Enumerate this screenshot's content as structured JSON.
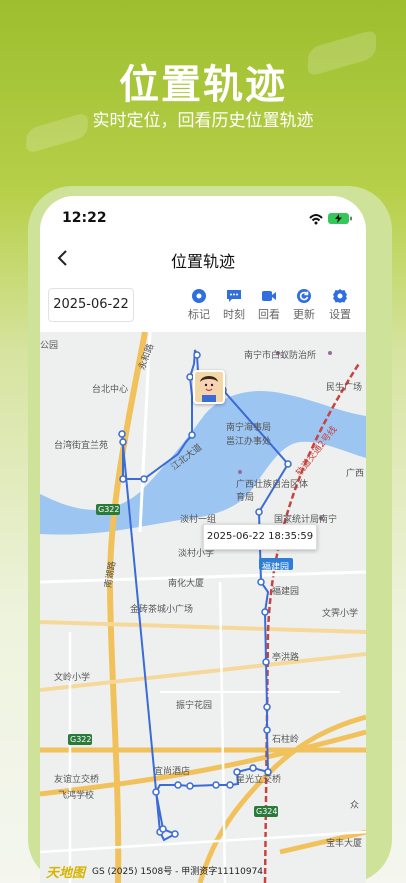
{
  "promo": {
    "title": "位置轨迹",
    "subtitle": "实时定位，回看历史位置轨迹"
  },
  "status_bar": {
    "time": "12:22"
  },
  "nav": {
    "title": "位置轨迹"
  },
  "toolbar": {
    "date": "2025-06-22",
    "tools": [
      "标记",
      "时刻",
      "回看",
      "更新",
      "设置"
    ]
  },
  "map": {
    "tooltip": "2025-06-22 18:35:59",
    "labels": {
      "gongyuan": "公园",
      "nanning_baiyi": "南宁市白蚁防治所",
      "minsheng": "民生广场",
      "taibei": "台北中心",
      "taiwan_jie": "台湾街宜兰苑",
      "nanning_hai": "南宁海事局",
      "yongjiang": "邕江办事处",
      "jiangbei": "江北大道",
      "guangxi_tiyu": "广西壮族自治区体育局",
      "guojia": "国家统计局南宁",
      "tanchun": "淡村一组",
      "g322_a": "G322",
      "nanhu": "南湖路",
      "tanchun_xiao": "淡村小学",
      "nanhua": "南化大厦",
      "fujian_a": "福建园",
      "fujian_b": "福建园",
      "jinzhuan": "金砖茶城小广场",
      "wenpai": "文霁小学",
      "tinghong": "亭洪路",
      "wenling": "文岭小学",
      "zhenning": "振宁花园",
      "shizhu": "石柱岭",
      "g322_b": "G322",
      "youyi": "友谊立交桥",
      "feihong": "飞鸿学校",
      "yishang": "宜尚酒店",
      "xingguang": "星光立交桥",
      "g324": "G324",
      "zhong": "众",
      "baofeng": "宝丰大厦",
      "guangxi": "广西",
      "metro": "轨道交通2号线",
      "yonghe": "永和路"
    },
    "footer": "GS (2025) 1508号 - 甲测资字11110974",
    "logo": "天地图"
  }
}
